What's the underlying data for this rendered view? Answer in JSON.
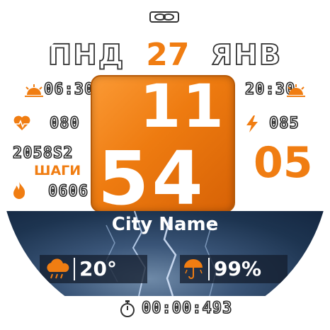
{
  "date": {
    "weekday": "ПНД",
    "day": "27",
    "month": "ЯНВ"
  },
  "sun": {
    "sunrise": "06:30",
    "sunset": "20:30"
  },
  "heart_rate": "080",
  "battery_value": "085",
  "steps": {
    "value": "2058S2",
    "label": "ШАГИ"
  },
  "calories": "0606",
  "time": {
    "hours": "11",
    "minutes": "54",
    "seconds": "05"
  },
  "weather": {
    "city": "City Name",
    "temperature": "20°",
    "precipitation": "99%"
  },
  "stopwatch": "00:00:493",
  "colors": {
    "accent": "#f07d12",
    "outline": "#2a2a2a",
    "weather_panel": "#1d3450"
  },
  "icons": [
    "logo-icon",
    "sunrise-icon",
    "sunset-icon",
    "heart-icon",
    "lightning-icon",
    "flame-icon",
    "rain-cloud-icon",
    "umbrella-icon",
    "stopwatch-icon"
  ]
}
